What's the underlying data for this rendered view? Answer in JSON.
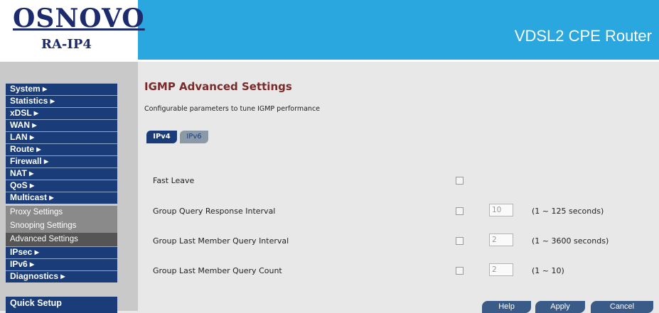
{
  "header": {
    "brand": "OSNOVO",
    "model": "RA-IP4",
    "title": "VDSL2 CPE Router"
  },
  "sidebar": {
    "items": [
      {
        "label": "System ▸"
      },
      {
        "label": "Statistics ▸"
      },
      {
        "label": "xDSL ▸"
      },
      {
        "label": "WAN ▸"
      },
      {
        "label": "LAN ▸"
      },
      {
        "label": "Route ▸"
      },
      {
        "label": "Firewall ▸"
      },
      {
        "label": "NAT ▸"
      },
      {
        "label": "QoS ▸"
      },
      {
        "label": "Multicast ▸"
      }
    ],
    "subitems": [
      {
        "label": "Proxy Settings"
      },
      {
        "label": "Snooping Settings"
      },
      {
        "label": "Advanced Settings"
      }
    ],
    "items_after": [
      {
        "label": "IPsec ▸"
      },
      {
        "label": "IPv6 ▸"
      },
      {
        "label": "Diagnostics ▸"
      }
    ],
    "quick_setup": "Quick Setup"
  },
  "main": {
    "title": "IGMP Advanced Settings",
    "description": "Configurable parameters to tune IGMP performance",
    "tabs": [
      {
        "label": "IPv4",
        "active": true
      },
      {
        "label": "IPv6",
        "active": false
      }
    ],
    "rows": [
      {
        "label": "Fast Leave",
        "checked": false
      },
      {
        "label": "Group Query Response Interval",
        "checked": false,
        "value": "10",
        "range": "(1 ~ 125 seconds)"
      },
      {
        "label": "Group Last Member Query Interval",
        "checked": false,
        "value": "2",
        "range": "(1 ~ 3600 seconds)"
      },
      {
        "label": "Group Last Member Query Count",
        "checked": false,
        "value": "2",
        "range": "(1 ~ 10)"
      }
    ],
    "buttons": {
      "help": "Help",
      "apply": "Apply",
      "cancel": "Cancel"
    }
  },
  "colors": {
    "header_bg": "#2aa7df",
    "nav_bg": "#1a3c78",
    "title_color": "#7a2a2a"
  }
}
